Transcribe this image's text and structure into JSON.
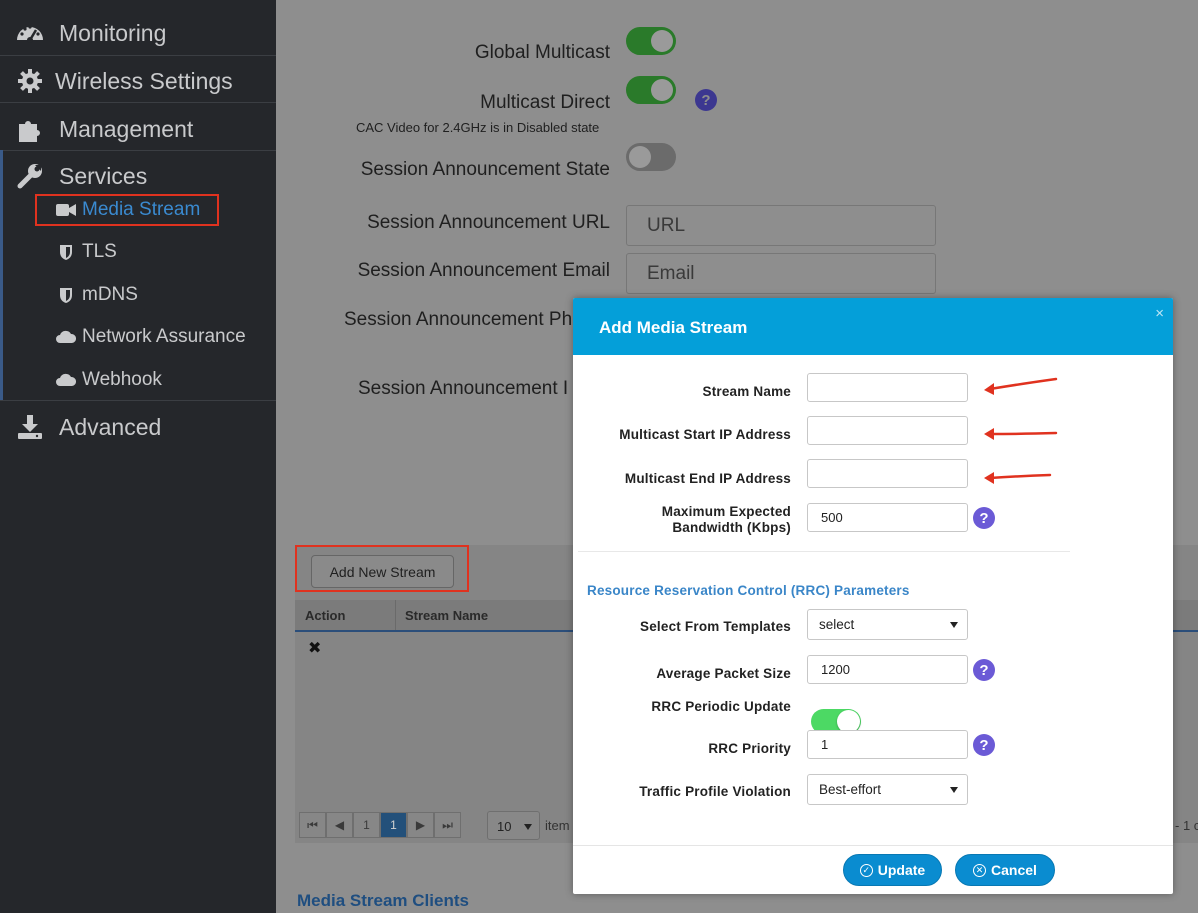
{
  "sidebar": {
    "items": [
      {
        "label": "Monitoring",
        "icon": "dashboard-icon"
      },
      {
        "label": "Wireless Settings",
        "icon": "gear-icon"
      },
      {
        "label": "Management",
        "icon": "puzzle-icon"
      },
      {
        "label": "Services",
        "icon": "wrench-icon"
      },
      {
        "label": "Advanced",
        "icon": "download-icon"
      }
    ],
    "services_sub": [
      {
        "label": "Media Stream",
        "icon": "video-camera-icon",
        "active": true
      },
      {
        "label": "TLS",
        "icon": "shield-icon"
      },
      {
        "label": "mDNS",
        "icon": "shield-icon"
      },
      {
        "label": "Network Assurance",
        "icon": "cloud-icon"
      },
      {
        "label": "Webhook",
        "icon": "cloud-icon"
      }
    ]
  },
  "main": {
    "global_multicast_label": "Global Multicast",
    "global_multicast_on": true,
    "multicast_direct_label": "Multicast Direct",
    "multicast_direct_on": true,
    "cac_note": "CAC Video for 2.4GHz is in Disabled state",
    "session_state_label": "Session Announcement State",
    "session_state_on": false,
    "session_url_label": "Session Announcement URL",
    "session_url_placeholder": "URL",
    "session_email_label": "Session Announcement Email",
    "session_email_placeholder": "Email",
    "session_phone_label_partial": "Session Announcement Ph",
    "session_note_label_partial": "Session Announcement I",
    "add_stream_button": "Add New Stream",
    "table_headers": [
      "Action",
      "Stream Name"
    ],
    "row_action_icon": "✖",
    "pager": {
      "first": "⏮",
      "prev": "◀",
      "pages": [
        "1",
        "1"
      ],
      "next": "▶",
      "last": "⏭",
      "per_page": "10",
      "items_label": "item",
      "range_partial": "- 1 c"
    },
    "clients_heading": "Media Stream Clients"
  },
  "modal": {
    "title": "Add Media Stream",
    "close": "×",
    "stream_name_label": "Stream Name",
    "start_ip_label": "Multicast Start IP Address",
    "end_ip_label": "Multicast End IP Address",
    "max_bw_label_1": "Maximum Expected",
    "max_bw_label_2": "Bandwidth (Kbps)",
    "max_bw_value": "500",
    "rrc_section": "Resource Reservation Control (RRC) Parameters",
    "templates_label": "Select From Templates",
    "templates_value": "select",
    "avg_packet_label": "Average Packet Size",
    "avg_packet_value": "1200",
    "rrc_periodic_label": "RRC Periodic Update",
    "rrc_periodic_on": true,
    "rrc_priority_label": "RRC Priority",
    "rrc_priority_value": "1",
    "traffic_violation_label": "Traffic Profile Violation",
    "traffic_violation_value": "Best-effort",
    "update_button": "Update",
    "cancel_button": "Cancel",
    "help_glyph": "?"
  },
  "colors": {
    "sidebar_bg": "#25272b",
    "modal_header": "#049fd9",
    "annotation_red": "#e0321f",
    "toggle_green": "#4cd964",
    "help_purple": "#6b5ad6"
  }
}
